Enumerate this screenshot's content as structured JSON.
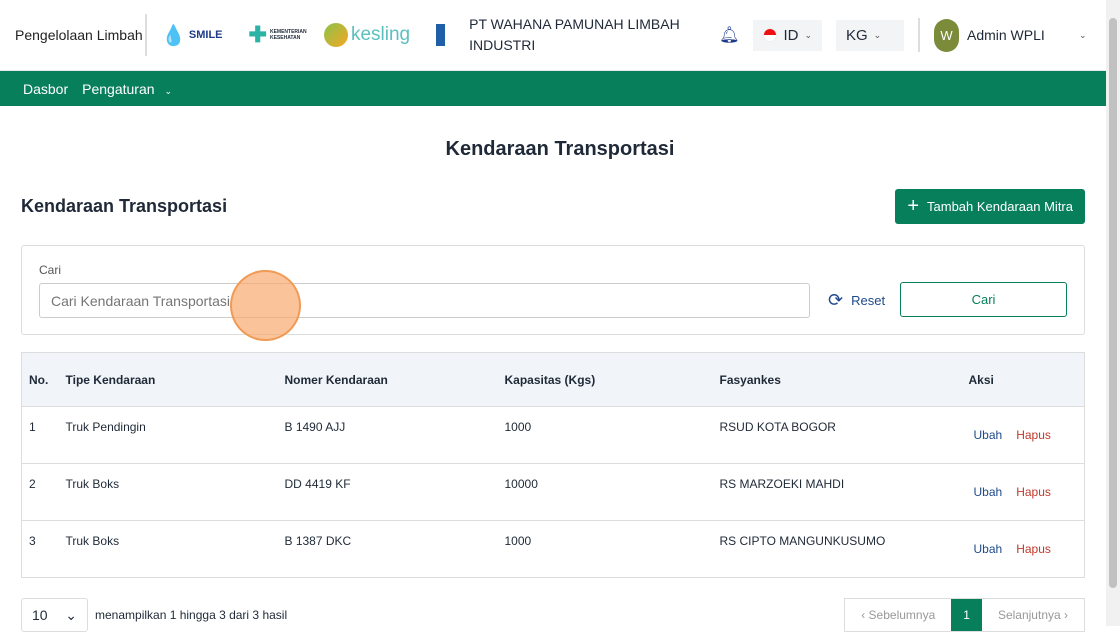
{
  "header": {
    "app_name": "Pengelolaan Limbah",
    "logos": [
      "SMILE",
      "Kementerian Kesehatan",
      "kesling",
      "UNDP"
    ],
    "company": "PT WAHANA PAMUNAH LIMBAH INDUSTRI",
    "language": "ID",
    "unit": "KG",
    "user_initial": "W",
    "user_name": "Admin WPLI"
  },
  "nav": {
    "items": [
      "Dasbor",
      "Pengaturan"
    ]
  },
  "page": {
    "title": "Kendaraan Transportasi",
    "section_title": "Kendaraan Transportasi",
    "add_button": "Tambah Kendaraan Mitra"
  },
  "search": {
    "label": "Cari",
    "placeholder": "Cari Kendaraan Transportasi",
    "reset": "Reset",
    "submit": "Cari"
  },
  "table": {
    "headers": [
      "No.",
      "Tipe Kendaraan",
      "Nomer Kendaraan",
      "Kapasitas (Kgs)",
      "Fasyankes",
      "Aksi"
    ],
    "rows": [
      [
        "1",
        "Truk Pendingin",
        "B 1490 AJJ",
        "1000",
        "RSUD KOTA BOGOR"
      ],
      [
        "2",
        "Truk Boks",
        "DD 4419 KF",
        "10000",
        "RS MARZOEKI MAHDI"
      ],
      [
        "3",
        "Truk Boks",
        "B 1387 DKC",
        "1000",
        "RS CIPTO MANGUNKUSUMO"
      ]
    ],
    "edit": "Ubah",
    "delete": "Hapus"
  },
  "footer": {
    "per_page": "10",
    "info": "menampilkan 1 hingga 3 dari 3 hasil",
    "prev": "‹  Sebelumnya",
    "page": "1",
    "next": "Selanjutnya  ›"
  },
  "colors": {
    "primary": "#087f5b",
    "link": "#1e4a8a",
    "danger": "#c0392b"
  }
}
